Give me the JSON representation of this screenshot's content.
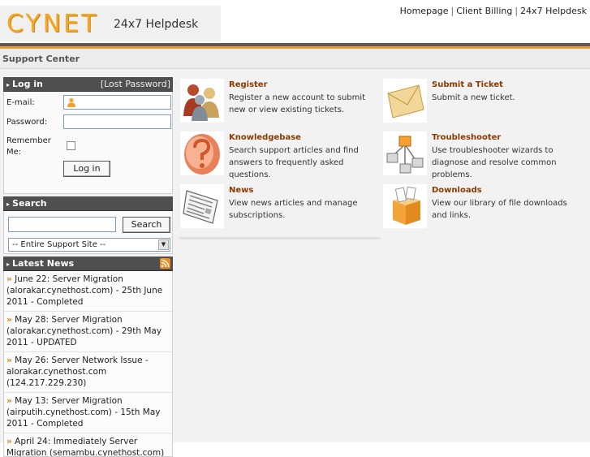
{
  "header": {
    "logo_text": "CYNET",
    "logo_subtitle": "24x7 Helpdesk",
    "links": [
      "Homepage",
      "Client Billing",
      "24x7 Helpdesk"
    ]
  },
  "subheader": {
    "title": "Support Center"
  },
  "login": {
    "heading": "Log in",
    "lost_password": "[Lost Password]",
    "email_label": "E-mail:",
    "password_label": "Password:",
    "remember_label_1": "Remember",
    "remember_label_2": "Me:",
    "button": "Log in"
  },
  "search": {
    "heading": "Search",
    "button": "Search",
    "scope": "-- Entire Support Site --"
  },
  "news": {
    "heading": "Latest News",
    "items": [
      {
        "l1": "June 22: Server Migration",
        "l2": "(alorakar.cynethost.com) - 25th June",
        "l3": "2011 - Completed"
      },
      {
        "l1": "May 28: Server Migration",
        "l2": "(alorakar.cynethost.com) - 29th May",
        "l3": "2011 - UPDATED"
      },
      {
        "l1": "May 26: Server Network Issue -",
        "l2": "alorakar.cynethost.com",
        "l3": "(124.217.229.230)"
      },
      {
        "l1": "May 13: Server Migration",
        "l2": "(airputih.cynethost.com) - 15th May",
        "l3": "2011 - Completed"
      },
      {
        "l1": "April 24: Immediately Server",
        "l2": "Migration (semambu.cynethost.com) -",
        "l3": ""
      }
    ]
  },
  "tiles": [
    {
      "title": "Register",
      "desc": "Register a new account to submit new or view existing tickets.",
      "icon": "users-icon"
    },
    {
      "title": "Submit a Ticket",
      "desc": "Submit a new ticket.",
      "icon": "envelope-icon"
    },
    {
      "title": "Knowledgebase",
      "desc": "Search support articles and find answers to frequently asked questions.",
      "icon": "question-mark-icon"
    },
    {
      "title": "Troubleshooter",
      "desc": "Use troubleshooter wizards to diagnose and resolve common problems.",
      "icon": "flowchart-icon"
    },
    {
      "title": "News",
      "desc": "View news articles and manage subscriptions.",
      "icon": "newspaper-icon"
    },
    {
      "title": "Downloads",
      "desc": "View our library of file downloads and links.",
      "icon": "box-icon"
    }
  ],
  "colors": {
    "accent": "#e89b2a",
    "title": "#8a3a00",
    "sidebar_head": "#4f4f4f"
  }
}
